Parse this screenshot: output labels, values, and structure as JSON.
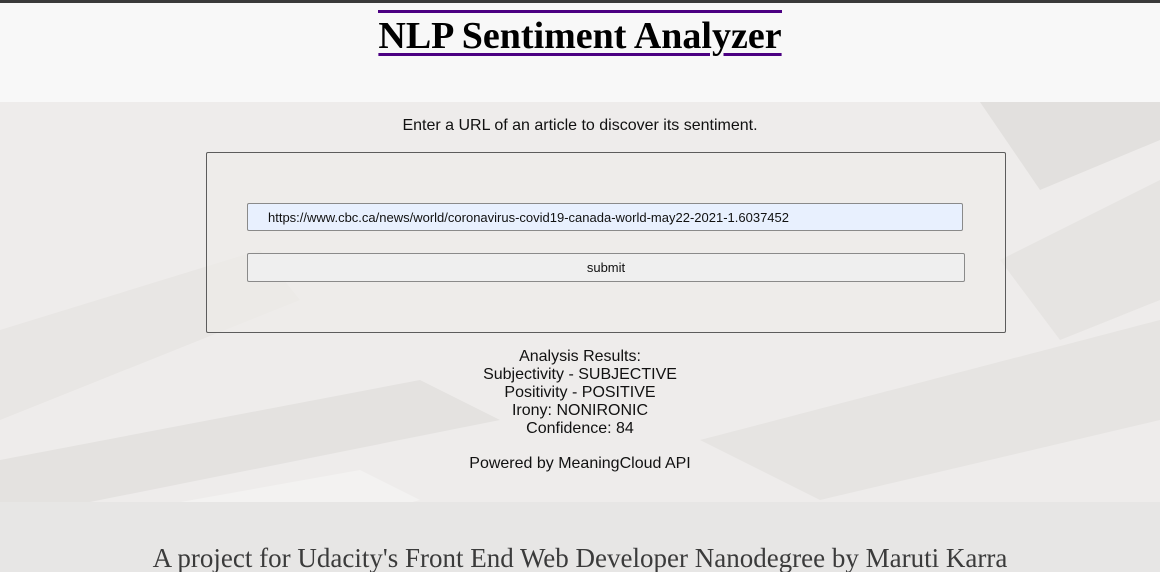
{
  "header": {
    "title": "NLP Sentiment Analyzer"
  },
  "form": {
    "instruction": "Enter a URL of an article to discover its sentiment.",
    "url_value": "https://www.cbc.ca/news/world/coronavirus-covid19-canada-world-may22-2021-1.6037452",
    "submit_label": "submit"
  },
  "results": {
    "heading": "Analysis Results:",
    "subjectivity": "Subjectivity - SUBJECTIVE",
    "positivity": "Positivity - POSITIVE",
    "irony": "Irony: NONIRONIC",
    "confidence": "Confidence: 84"
  },
  "powered_by": "Powered by MeaningCloud API",
  "footer": {
    "text": "A project for Udacity's Front End Web Developer Nanodegree by Maruti Karra"
  },
  "colors": {
    "title_rule": "#4b0082",
    "input_background": "#e8f0fe",
    "page_background": "#eeeceb"
  }
}
